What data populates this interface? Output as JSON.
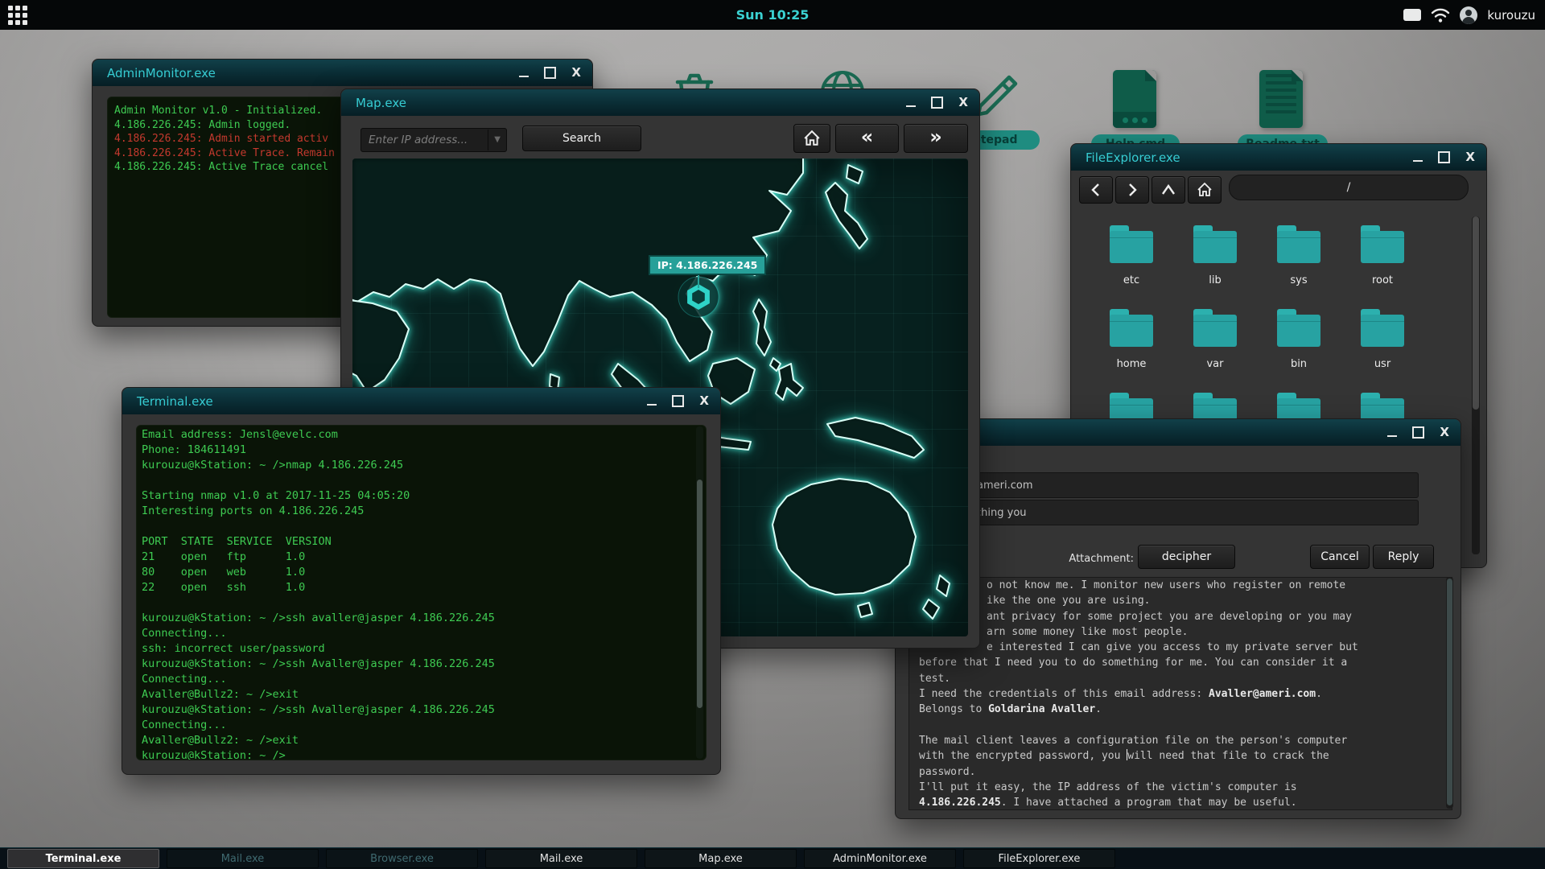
{
  "topbar": {
    "clock": "Sun 10:25",
    "username": "kurouzu"
  },
  "window_controls": {
    "close": "X"
  },
  "desktop_icons": {
    "notepad_label": "Notepad",
    "file1_label": "Help.cmd",
    "file2_label": "Readme.txt"
  },
  "admin_monitor": {
    "title": "AdminMonitor.exe",
    "lines": [
      {
        "text": "Admin Monitor v1.0 - Initialized.",
        "color": "green"
      },
      {
        "text": "4.186.226.245: Admin logged.",
        "color": "green"
      },
      {
        "text": "4.186.226.245: Admin started activ",
        "color": "red"
      },
      {
        "text": "4.186.226.245: Active Trace. Remain",
        "color": "red"
      },
      {
        "text": "4.186.226.245: Active Trace cancel",
        "color": "green"
      }
    ]
  },
  "map": {
    "title": "Map.exe",
    "search_placeholder": "Enter IP address...",
    "search_button": "Search",
    "nav_back": "«",
    "nav_forward": "»",
    "ip_tooltip": "IP: 4.186.226.245"
  },
  "terminal": {
    "title": "Terminal.exe",
    "lines": [
      "Email address: Jensl@evelc.com",
      "Phone: 184611491",
      "kurouzu@kStation: ~ />nmap 4.186.226.245",
      "",
      "Starting nmap v1.0 at 2017-11-25 04:05:20",
      "Interesting ports on 4.186.226.245",
      "",
      "PORT  STATE  SERVICE  VERSION",
      "21    open   ftp      1.0",
      "80    open   web      1.0",
      "22    open   ssh      1.0",
      "",
      "kurouzu@kStation: ~ />ssh avaller@jasper 4.186.226.245",
      "Connecting...",
      "ssh: incorrect user/password",
      "kurouzu@kStation: ~ />ssh Avaller@jasper 4.186.226.245",
      "Connecting...",
      "Avaller@Bullz2: ~ />exit",
      "kurouzu@kStation: ~ />ssh Avaller@jasper 4.186.226.245",
      "Connecting...",
      "Avaller@Bullz2: ~ />exit",
      "kurouzu@kStation: ~ />"
    ]
  },
  "file_explorer": {
    "title": "FileExplorer.exe",
    "path": "/",
    "folder_rows": [
      [
        "etc",
        "lib",
        "sys",
        "root"
      ],
      [
        "home",
        "var",
        "bin",
        "usr"
      ]
    ],
    "partial_row_icons": 4
  },
  "mail": {
    "to_visible": "ameri.com",
    "subject_visible": "ching you",
    "attachment_label": "Attachment:",
    "attachment_button": "decipher",
    "cancel_button": "Cancel",
    "reply_button": "Reply",
    "body_lines": [
      {
        "pad": true,
        "segs": [
          {
            "t": "o not know me. I monitor new users who register on remote"
          }
        ]
      },
      {
        "pad": true,
        "segs": [
          {
            "t": "ike the one you are using."
          }
        ]
      },
      {
        "pad": true,
        "segs": [
          {
            "t": "ant privacy for some project you are developing or you may"
          }
        ]
      },
      {
        "pad": true,
        "segs": [
          {
            "t": "arn some money like most people."
          }
        ]
      },
      {
        "pad": true,
        "segs": [
          {
            "t": "e interested I can give you access to my private server but"
          }
        ]
      },
      {
        "segs": [
          {
            "t": "before that I need you to do something for me. You can consider it a"
          }
        ]
      },
      {
        "segs": [
          {
            "t": "test."
          }
        ]
      },
      {
        "segs": [
          {
            "t": "I need the credentials of this email address: "
          },
          {
            "t": "Avaller@ameri.com",
            "b": 1
          },
          {
            "t": "."
          }
        ]
      },
      {
        "segs": [
          {
            "t": "Belongs to "
          },
          {
            "t": "Goldarina Avaller",
            "b": 1
          },
          {
            "t": "."
          }
        ]
      },
      {
        "segs": []
      },
      {
        "segs": [
          {
            "t": "The mail client leaves a configuration file on the person's computer"
          }
        ]
      },
      {
        "segs": [
          {
            "t": "with the encrypted password, you "
          },
          {
            "c": 1
          },
          {
            "t": "will need that file to crack the"
          }
        ]
      },
      {
        "segs": [
          {
            "t": "password."
          }
        ]
      },
      {
        "segs": [
          {
            "t": "I'll put it easy, the IP address of the victim's computer is"
          }
        ]
      },
      {
        "segs": [
          {
            "t": "4.186.226.245",
            "b": 1
          },
          {
            "t": ". I have attached a program that may be useful."
          }
        ]
      }
    ]
  },
  "taskbar": {
    "items": [
      {
        "label": "Terminal.exe",
        "state": "active"
      },
      {
        "label": "Mail.exe",
        "state": "dim"
      },
      {
        "label": "Browser.exe",
        "state": "dim"
      },
      {
        "label": "Mail.exe",
        "state": "normal"
      },
      {
        "label": "Map.exe",
        "state": "normal"
      },
      {
        "label": "AdminMonitor.exe",
        "state": "normal"
      },
      {
        "label": "FileExplorer.exe",
        "state": "normal"
      }
    ]
  },
  "colors": {
    "titlebar_teal": "#36ccd2",
    "terminal_green": "#3ecb52",
    "alert_red": "#c4392e",
    "folder_teal": "#27a2a2",
    "map_marker_teal": "#2fd3c8",
    "desktop_icon_green": "#1a6b53",
    "tooltip_bg": "#27a099"
  }
}
